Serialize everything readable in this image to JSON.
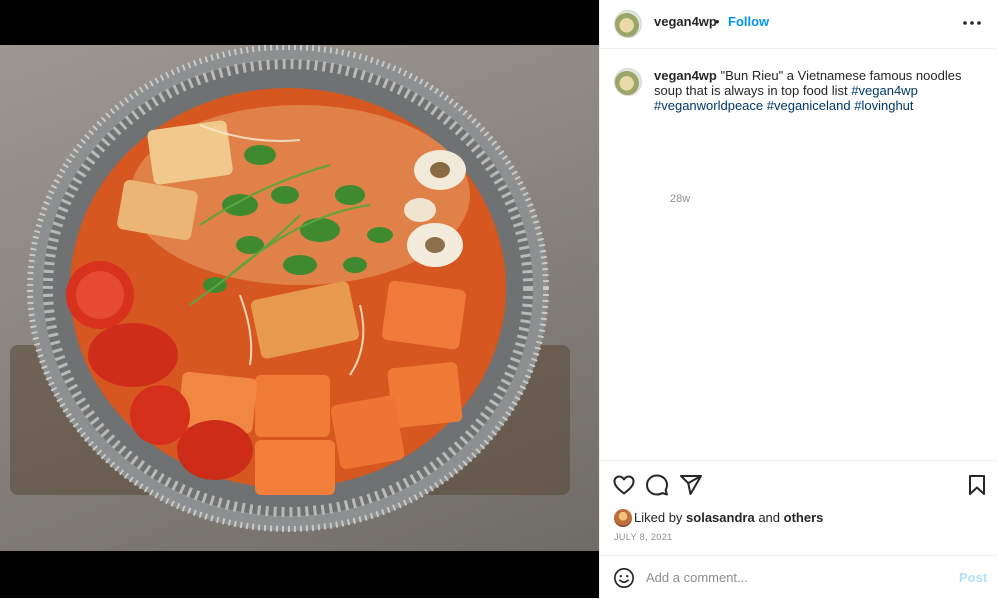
{
  "post": {
    "username": "vegan4wp",
    "follow_label": "Follow",
    "separator": "•",
    "caption_username": "vegan4wp",
    "caption_text": "\"Bun Rieu\" a Vietnamese famous noodles soup that is always in top food list",
    "hashtags": [
      "#vegan4wp",
      "#veganworldpeace",
      "#veganiceland",
      "#lovinghut"
    ],
    "time_ago": "28w",
    "liked_prefix": "Liked by",
    "liked_user": "solasandra",
    "liked_and": "and",
    "liked_others": "others",
    "date": "JULY 8, 2021"
  },
  "comment": {
    "placeholder": "Add a comment...",
    "post_label": "Post"
  },
  "icons": [
    "more-options-icon",
    "heart-icon",
    "comment-icon",
    "share-icon",
    "bookmark-icon",
    "emoji-icon"
  ],
  "colors": {
    "link_blue": "#0095f6",
    "hashtag": "#00376b",
    "post_disabled": "#b2dffc",
    "muted": "#8e8e8e"
  }
}
